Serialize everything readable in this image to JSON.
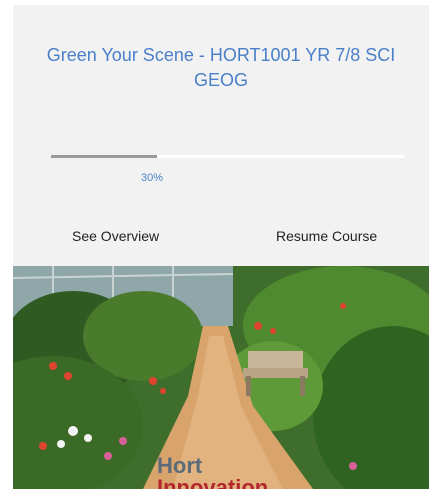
{
  "course": {
    "title": "Green Your Scene - HORT1001 YR 7/8 SCI GEOG",
    "progress_percent": 30,
    "progress_label": "30%",
    "see_overview_label": "See Overview",
    "resume_course_label": "Resume Course"
  },
  "image": {
    "description_icon": "garden-photo",
    "logo_line1": "Hort",
    "logo_line2": "Innovation"
  },
  "colors": {
    "title": "#4a7fc9",
    "card_background": "#f2f2f2",
    "progress_fill": "#9a9a9a"
  }
}
